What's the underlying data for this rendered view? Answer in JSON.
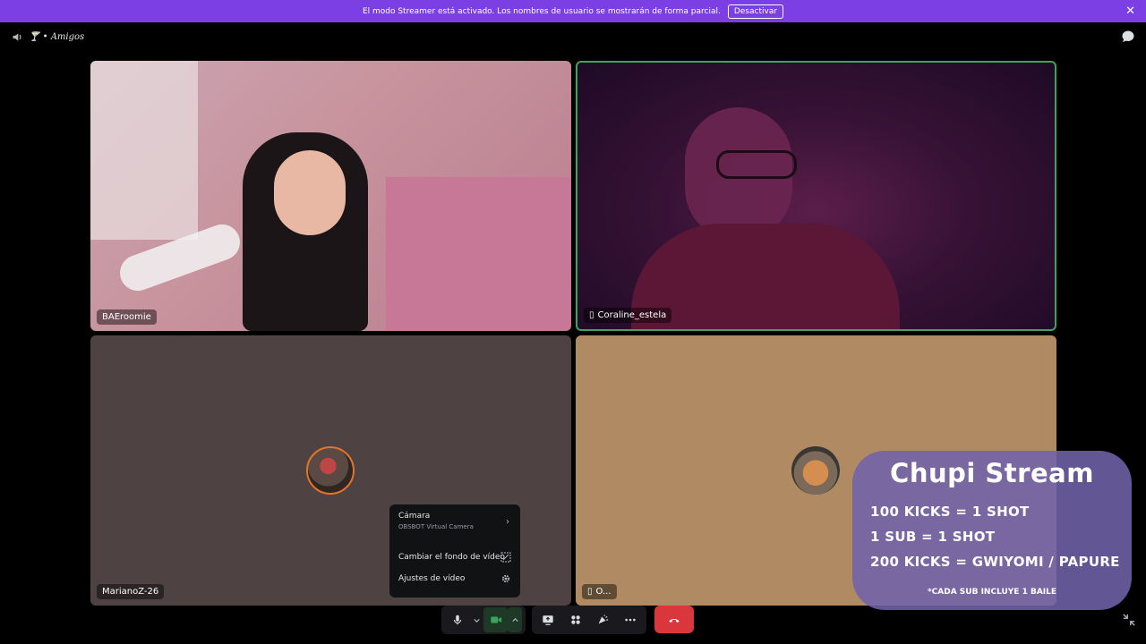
{
  "banner": {
    "message": "El modo Streamer está activado. Los nombres de usuario se mostrarán de forma parcial.",
    "deactivate_label": "Desactivar",
    "background": "#7b3fe4"
  },
  "topbar": {
    "channel_name": "🍸 • Amigos",
    "icons": [
      "speaker-icon",
      "chat-bubble-icon"
    ]
  },
  "tiles": [
    {
      "username": "BAEroomie",
      "device_icon": null
    },
    {
      "username": "Coraline_estela",
      "device_icon": "mobile-icon",
      "speaking": true,
      "border_color": "#3aa55d"
    },
    {
      "username": "MarianoZ-26",
      "device_icon": null
    },
    {
      "username": "O...",
      "device_icon": "mobile-icon"
    }
  ],
  "video_menu": {
    "camera_label": "Cámara",
    "camera_device": "OBSBOT Virtual Camera",
    "change_background_label": "Cambiar el fondo de vídeo",
    "video_settings_label": "Ajustes de vídeo"
  },
  "controls": {
    "icons": [
      "microphone-icon",
      "chevron-down-icon",
      "camera-icon",
      "chevron-up-icon",
      "screen-share-icon",
      "activities-icon",
      "soundboard-icon",
      "more-icon",
      "hang-up-icon",
      "collapse-icon"
    ],
    "hangup_color": "#da373c"
  },
  "stream_overlay": {
    "title": "Chupi Stream",
    "lines": [
      "100 KICKS = 1 SHOT",
      "1 SUB = 1 SHOT",
      "200 KICKS = GWIYOMI / PAPURE"
    ],
    "note": "*CADA SUB INCLUYE 1 BAILE"
  }
}
